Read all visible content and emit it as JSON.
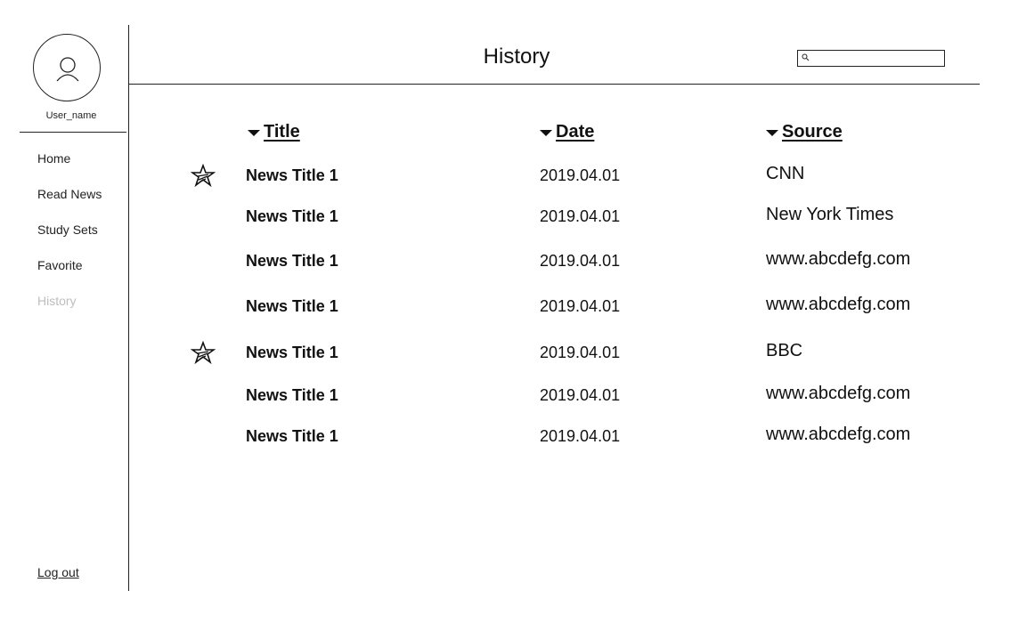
{
  "sidebar": {
    "username": "User_name",
    "nav": [
      {
        "label": "Home",
        "active": false
      },
      {
        "label": "Read News",
        "active": false
      },
      {
        "label": "Study Sets",
        "active": false
      },
      {
        "label": "Favorite",
        "active": false
      },
      {
        "label": "History",
        "active": true
      }
    ],
    "logout_label": "Log out"
  },
  "header": {
    "title": "History",
    "search": {
      "placeholder": "",
      "value": "",
      "icon": "search-icon"
    }
  },
  "table": {
    "columns": [
      {
        "label": "Title",
        "sort_icon": "caret-down-icon"
      },
      {
        "label": "Date",
        "sort_icon": "caret-down-icon"
      },
      {
        "label": "Source",
        "sort_icon": "caret-down-icon"
      }
    ],
    "rows": [
      {
        "starred": true,
        "title": "News Title 1",
        "date": "2019.04.01",
        "source": "CNN"
      },
      {
        "starred": false,
        "title": "News Title 1",
        "date": "2019.04.01",
        "source": "New York Times"
      },
      {
        "starred": false,
        "title": "News Title 1",
        "date": "2019.04.01",
        "source": "www.abcdefg.com"
      },
      {
        "starred": false,
        "title": "News Title 1",
        "date": "2019.04.01",
        "source": "www.abcdefg.com"
      },
      {
        "starred": true,
        "title": "News Title 1",
        "date": "2019.04.01",
        "source": "BBC"
      },
      {
        "starred": false,
        "title": "News Title 1",
        "date": "2019.04.01",
        "source": "www.abcdefg.com"
      },
      {
        "starred": false,
        "title": "News Title 1",
        "date": "2019.04.01",
        "source": "www.abcdefg.com"
      }
    ]
  }
}
